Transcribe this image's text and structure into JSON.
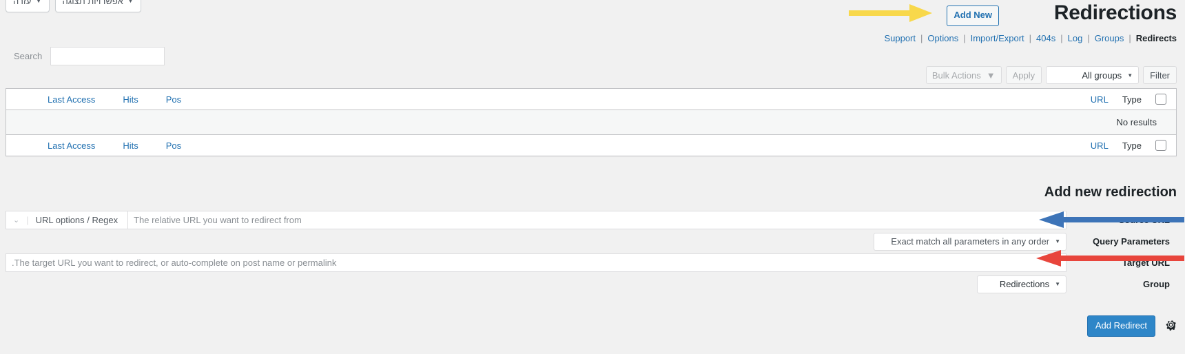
{
  "top_tabs": [
    {
      "label": "עזרה",
      "icon": "caret-down-icon"
    },
    {
      "label": "אפשרויות תצוגה",
      "icon": "caret-down-icon"
    }
  ],
  "header": {
    "title": "Redirections",
    "add_new_label": "Add New"
  },
  "subnav": {
    "items": [
      {
        "label": "Support",
        "current": false
      },
      {
        "label": "Options",
        "current": false
      },
      {
        "label": "Import/Export",
        "current": false
      },
      {
        "label": "404s",
        "current": false
      },
      {
        "label": "Log",
        "current": false
      },
      {
        "label": "Groups",
        "current": false
      },
      {
        "label": "Redirects",
        "current": true
      }
    ],
    "separator": "|"
  },
  "search": {
    "label": "Search",
    "value": "",
    "placeholder": ""
  },
  "filter_bar": {
    "filter_label": "Filter",
    "groups_select": "All groups",
    "apply_label": "Apply",
    "bulk_actions_label": "Bulk Actions",
    "arrow_glyph": "▼"
  },
  "table": {
    "columns_left": [
      "Last Access",
      "Hits",
      "Pos"
    ],
    "columns_right": [
      "URL",
      "Type"
    ],
    "empty_message": "No results"
  },
  "form": {
    "title": "Add new redirection",
    "rows": [
      {
        "label": "Source URL",
        "placeholder": "The relative URL you want to redirect from",
        "options_label": "URL options / Regex"
      },
      {
        "label": "Query Parameters",
        "value": "Exact match all parameters in any order"
      },
      {
        "label": "Target URL",
        "placeholder": ".The target URL you want to redirect, or auto-complete on post name or permalink"
      },
      {
        "label": "Group",
        "value": "Redirections"
      }
    ],
    "add_redirect_label": "Add Redirect",
    "gear_icon": "gear-icon",
    "gear_glyph": "✲"
  },
  "annotations": [
    {
      "name": "yellow-arrow",
      "color": "#f7d74a",
      "points_to": "Add New"
    },
    {
      "name": "blue-arrow",
      "color": "#3b73b9",
      "points_to": "Source URL"
    },
    {
      "name": "red-arrow",
      "color": "#e03c31",
      "points_to": "Target URL"
    }
  ],
  "colors": {
    "link": "#2271b1",
    "page_bg": "#f1f1f1",
    "primary_button": "#2e86c8"
  }
}
